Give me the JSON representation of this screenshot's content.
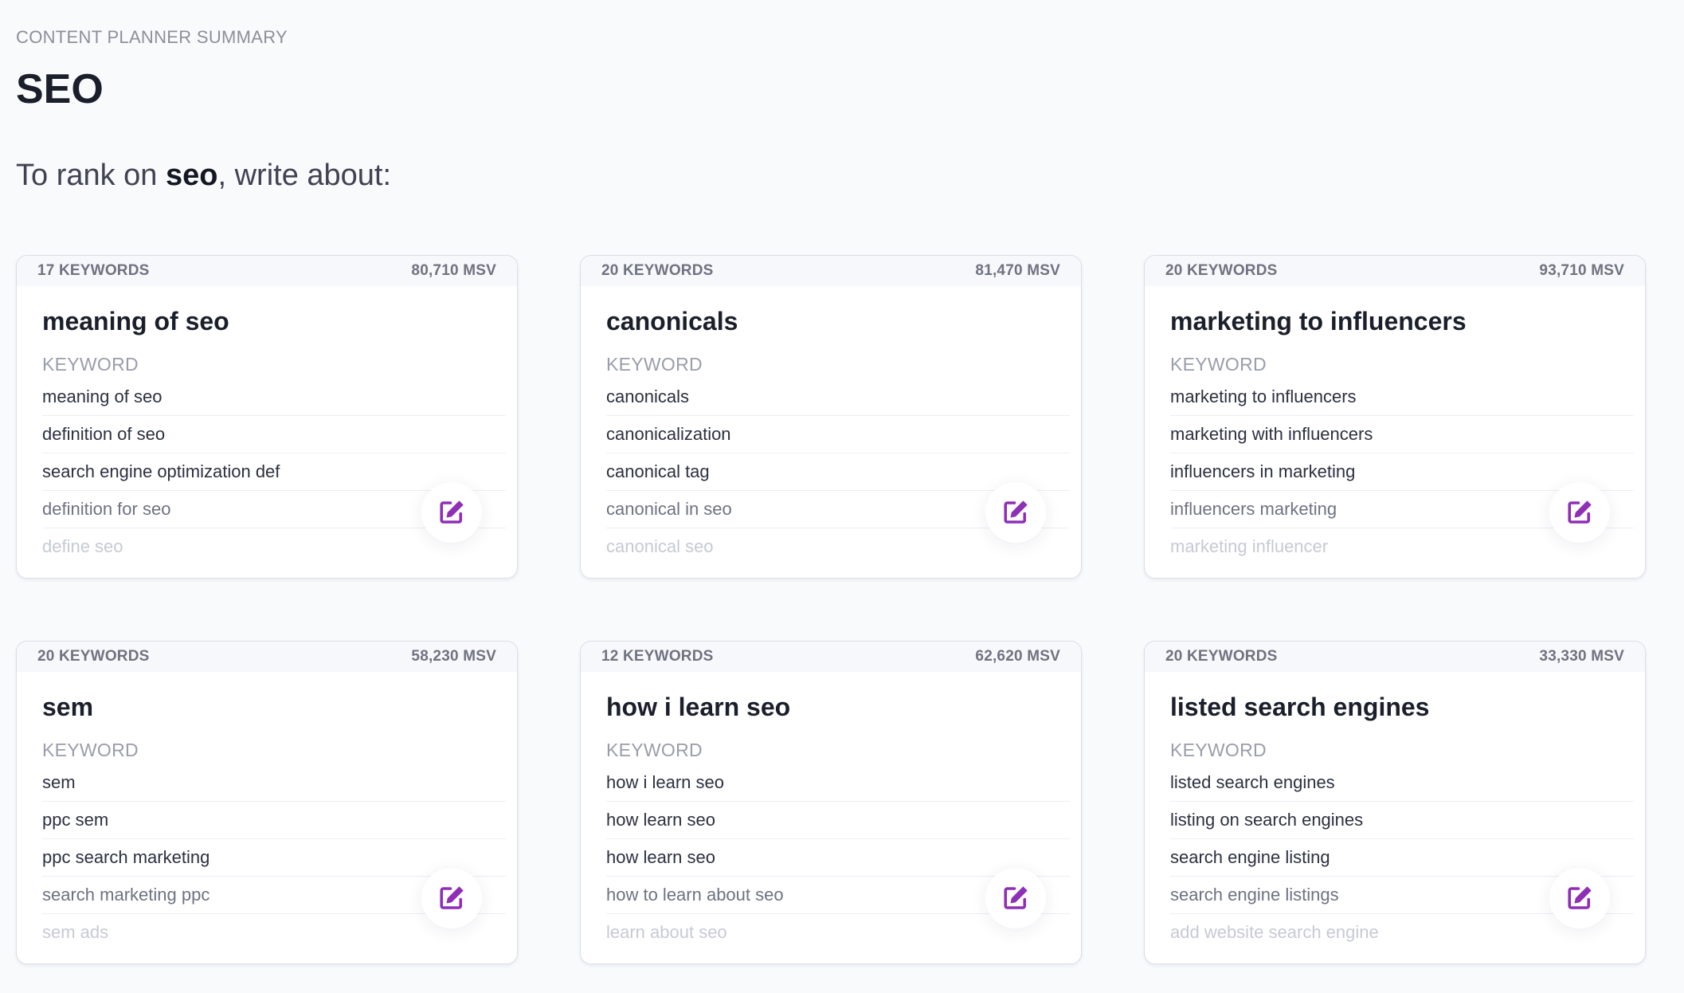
{
  "header": {
    "eyebrow": "CONTENT PLANNER SUMMARY",
    "title": "SEO",
    "subtitle_prefix": "To rank on ",
    "subtitle_term": "seo",
    "subtitle_suffix": ", write about:"
  },
  "column_label": "KEYWORD",
  "accent_color": "#8e2fb5",
  "edit_icon": "edit-icon",
  "cards": [
    {
      "keywords_count": "17 KEYWORDS",
      "msv": "80,710 MSV",
      "title": "meaning of seo",
      "keywords": [
        "meaning of seo",
        "definition of seo",
        "search engine optimization def",
        "definition for seo",
        "define seo"
      ]
    },
    {
      "keywords_count": "20 KEYWORDS",
      "msv": "81,470 MSV",
      "title": "canonicals",
      "keywords": [
        "canonicals",
        "canonicalization",
        "canonical tag",
        "canonical in seo",
        "canonical seo"
      ]
    },
    {
      "keywords_count": "20 KEYWORDS",
      "msv": "93,710 MSV",
      "title": "marketing to influencers",
      "keywords": [
        "marketing to influencers",
        "marketing with influencers",
        "influencers in marketing",
        "influencers marketing",
        "marketing influencer"
      ]
    },
    {
      "keywords_count": "20 KEYWORDS",
      "msv": "58,230 MSV",
      "title": "sem",
      "keywords": [
        "sem",
        "ppc sem",
        "ppc search marketing",
        "search marketing ppc",
        "sem ads"
      ]
    },
    {
      "keywords_count": "12 KEYWORDS",
      "msv": "62,620 MSV",
      "title": "how i learn seo",
      "keywords": [
        "how i learn seo",
        "how learn seo",
        "how learn seo",
        "how to learn about seo",
        "learn about seo"
      ]
    },
    {
      "keywords_count": "20 KEYWORDS",
      "msv": "33,330 MSV",
      "title": "listed search engines",
      "keywords": [
        "listed search engines",
        "listing on search engines",
        "search engine listing",
        "search engine listings",
        "add website search engine"
      ]
    }
  ]
}
